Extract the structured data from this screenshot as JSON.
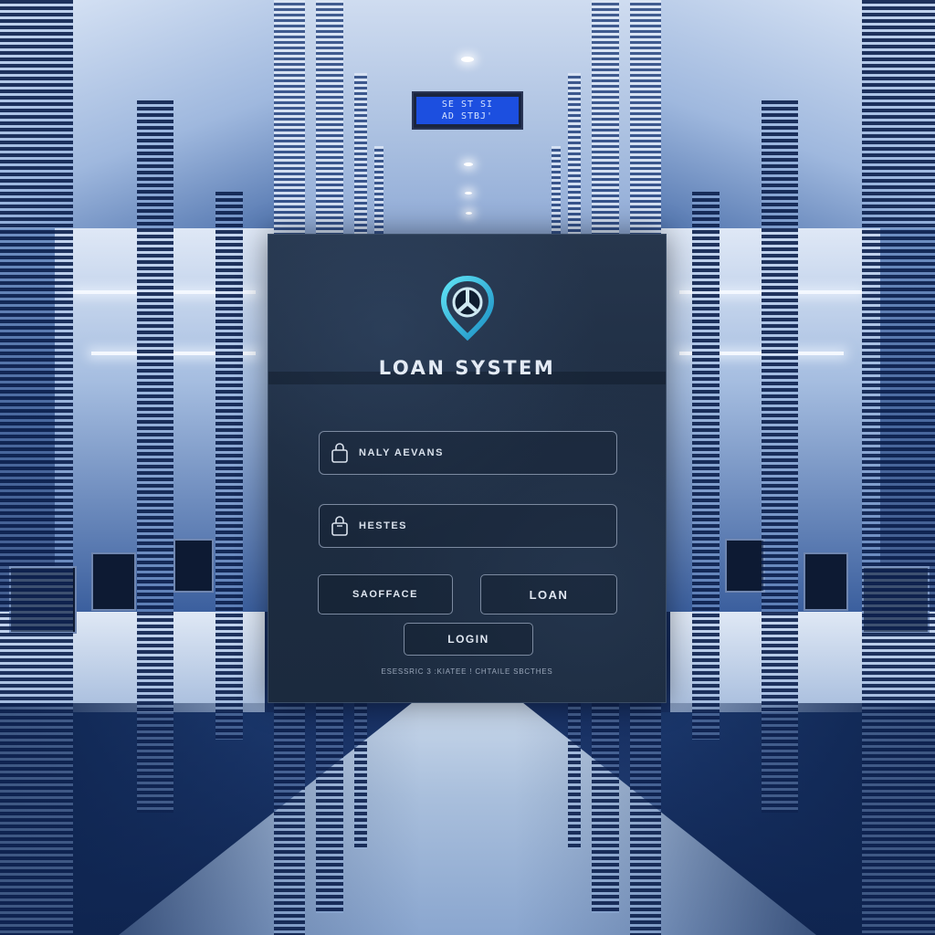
{
  "ceiling_sign": {
    "line1": "SE ST SI",
    "line2": "AD STBJ'"
  },
  "login": {
    "logo_icon": "map-pin-icon",
    "title": "LOAN SYSTEM",
    "username": {
      "icon": "lock-icon",
      "value": "NALY AEVANS"
    },
    "password": {
      "icon": "lock-icon",
      "value": "HESTES"
    },
    "buttons": {
      "left_label": "SAOFFACE",
      "right_label": "LOAN",
      "login_label": "LOGIN"
    },
    "footer": "ESESSRIC 3 :KIATEE ! CHTAILE SBCTHES"
  },
  "colors": {
    "accent": "#2fb8d8",
    "panel": "#1e2d42",
    "border": "#7c8aa0",
    "text": "#e4ebf5"
  }
}
